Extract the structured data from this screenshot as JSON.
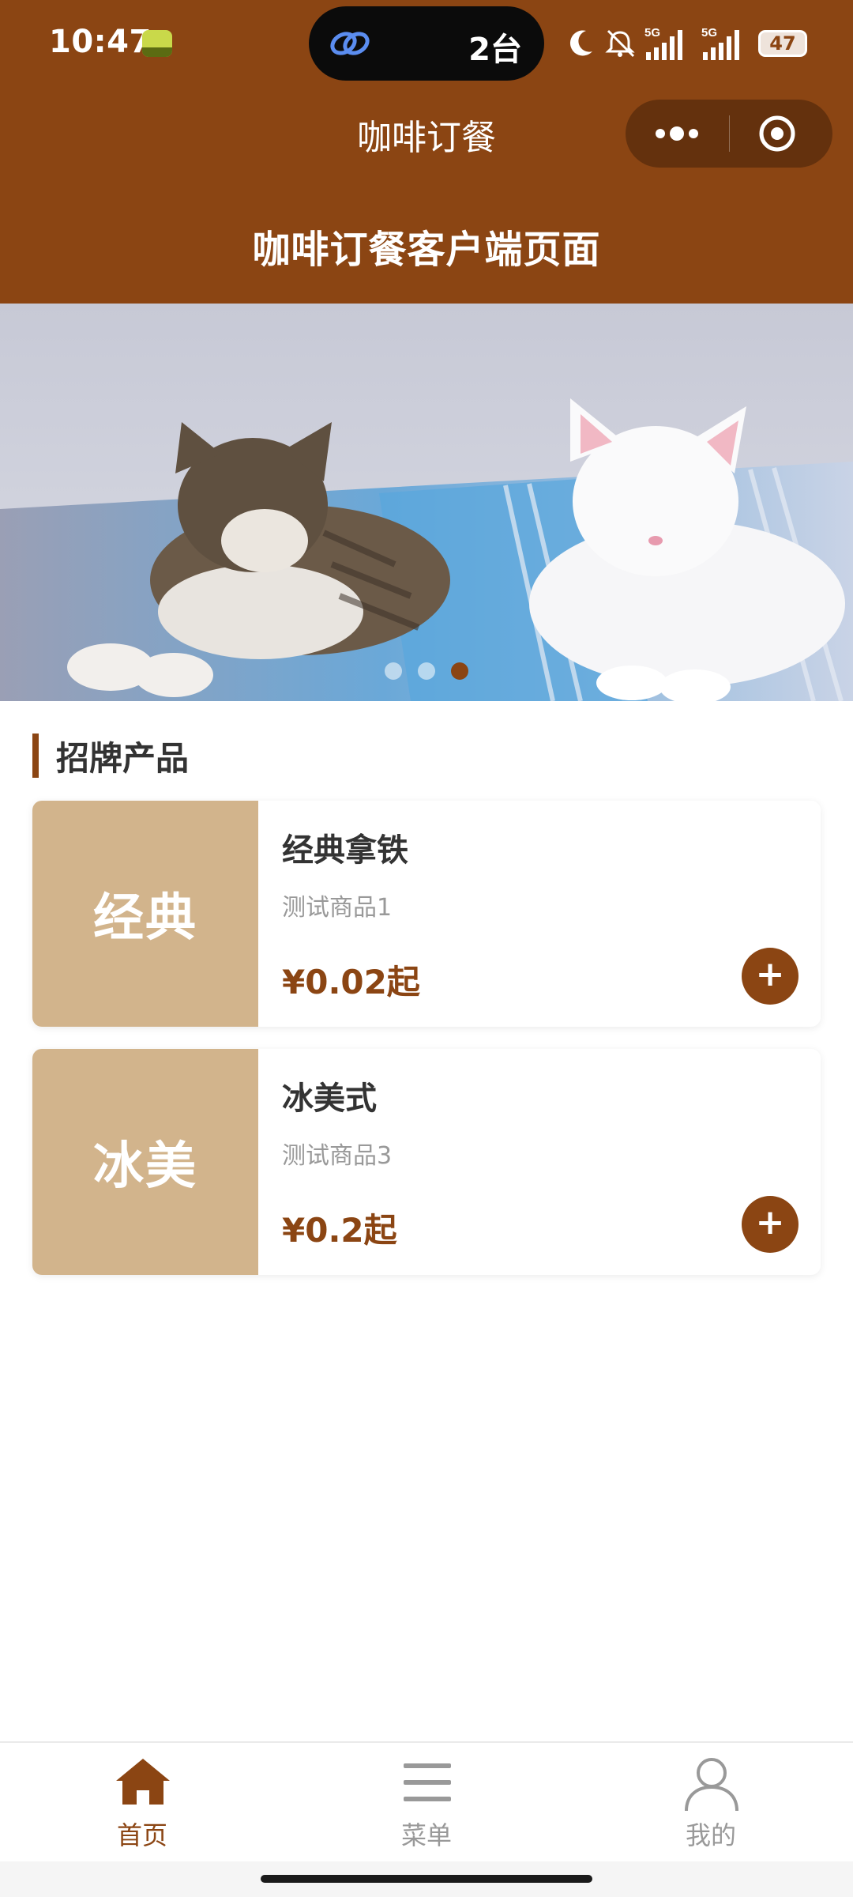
{
  "status_bar": {
    "time": "10:47",
    "devices_label": "2台",
    "battery": "47",
    "signal_labels": [
      "5G",
      "5G"
    ],
    "icons": [
      "app-notification-icon",
      "link-icon",
      "moon-icon",
      "mute-icon",
      "signal-5g-icon",
      "signal-5g-icon",
      "battery-icon"
    ]
  },
  "navbar": {
    "title": "咖啡订餐",
    "more_icon": "more-dots-icon",
    "close_icon": "target-close-icon"
  },
  "header": {
    "title": "咖啡订餐客户端页面"
  },
  "banner": {
    "image_subject": "two kittens lying on a blanket",
    "slide_count": 3,
    "active_slide": 3
  },
  "section": {
    "title": "招牌产品"
  },
  "products": [
    {
      "thumb_label": "经典",
      "name": "经典拿铁",
      "desc": "测试商品1",
      "price": "¥0.02起",
      "add_label": "+"
    },
    {
      "thumb_label": "冰美",
      "name": "冰美式",
      "desc": "测试商品3",
      "price": "¥0.2起",
      "add_label": "+"
    }
  ],
  "tabbar": {
    "items": [
      {
        "label": "首页",
        "icon": "home-icon",
        "active": true
      },
      {
        "label": "菜单",
        "icon": "menu-icon",
        "active": false
      },
      {
        "label": "我的",
        "icon": "user-icon",
        "active": false
      }
    ]
  },
  "colors": {
    "brand": "#8B4513",
    "thumb": "#D2B48C",
    "text_dark": "#333333",
    "text_muted": "#999999"
  }
}
